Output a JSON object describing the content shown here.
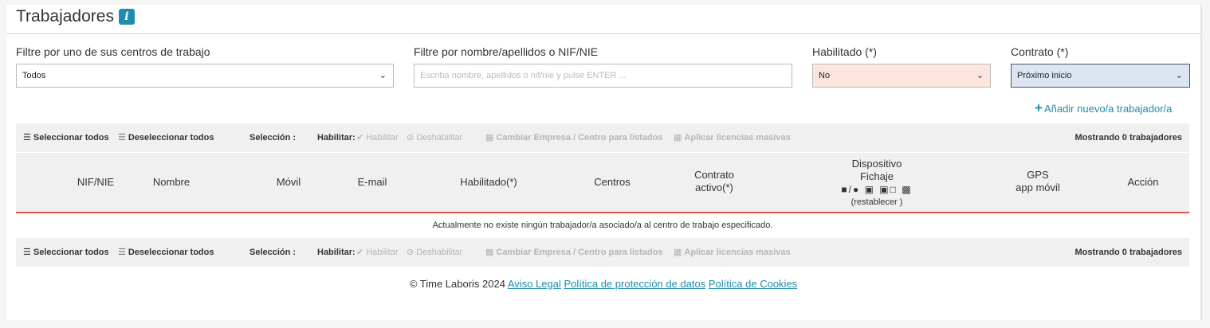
{
  "page": {
    "title": "Trabajadores",
    "info_icon": "i"
  },
  "filters": {
    "center_label": "Filtre por uno de sus centros de trabajo",
    "center_value": "Todos",
    "name_label": "Filtre por nombre/apellidos o NIF/NIE",
    "name_placeholder": "Escriba nombre, apellidos o nif/nie y pulse ENTER ...",
    "enabled_label": "Habilitado (*)",
    "enabled_value": "No",
    "contract_label": "Contrato (*)",
    "contract_value": "Próximo inicio"
  },
  "add_link": "Añadir nuevo/a trabajador/a",
  "toolbar": {
    "select_all": "Seleccionar todos",
    "deselect_all": "Deseleccionar todos",
    "selection": "Selección :",
    "enable_prefix": "Habilitar:",
    "enable": "Habilitar",
    "disable": "Deshabilitar",
    "change_company": "Cambiar Empresa / Centro para listados",
    "apply_licenses": "Aplicar licencias masivas",
    "showing": "Mostrando 0 trabajadores"
  },
  "columns": {
    "nif": "NIF/NIE",
    "name": "Nombre",
    "mobile": "Móvil",
    "email": "E-mail",
    "enabled": "Habilitado(*)",
    "centers": "Centros",
    "contract_line1": "Contrato",
    "contract_line2": "activo(*)",
    "device_line1": "Dispositivo",
    "device_line2": "Fichaje",
    "device_reset": "(restablecer )",
    "gps_line1": "GPS",
    "gps_line2": "app móvil",
    "action": "Acción"
  },
  "empty_message": "Actualmente no existe ningún trabajador/a asociado/a al centro de trabajo especificado.",
  "footer": {
    "copyright": "© Time Laboris 2024",
    "legal": "Aviso Legal",
    "privacy": "Política de protección de datos",
    "cookies": "Política de Cookies"
  },
  "colors": {
    "accent": "#1e8dad",
    "enabled_bg": "#fbe5dc",
    "contract_bg": "#dbe6f2",
    "table_rule": "#d9534f"
  },
  "icons": [
    "info-icon",
    "chevron-down-icon",
    "plus-icon",
    "list-icon",
    "check-icon",
    "ban-icon",
    "building-icon",
    "android-apple-icon",
    "window-icon",
    "glasses-icon",
    "qr-icon"
  ]
}
